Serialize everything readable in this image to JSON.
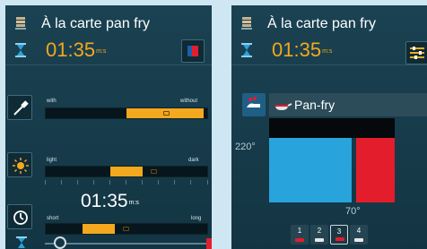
{
  "left": {
    "title": "À la carte pan fry",
    "time": "01:35",
    "time_unit": "m:s",
    "sliders": {
      "with_without": {
        "left_label": "with",
        "right_label": "without",
        "level": 0.5
      },
      "light_dark": {
        "left_label": "light",
        "right_label": "dark",
        "level": 0.5
      },
      "short_long": {
        "left_label": "short",
        "right_label": "long",
        "level": 0.33
      }
    },
    "mid_time": "01:35",
    "mid_time_unit": "m:s"
  },
  "right": {
    "title": "À la carte pan fry",
    "time": "01:35",
    "time_unit": "m:s",
    "program": "Pan-fry",
    "temp_top": "220°",
    "temp_core": "70°",
    "steps": [
      {
        "label": "1",
        "active": false,
        "color": "#e31d2b"
      },
      {
        "label": "2",
        "active": false,
        "color": "#e8e8e8"
      },
      {
        "label": "3",
        "active": true,
        "color": "#e31d2b"
      },
      {
        "label": "4",
        "active": false,
        "color": "#e8e8e8"
      }
    ]
  },
  "colors": {
    "accent": "#f4a81d",
    "steam_blue": "#29a3dc",
    "heat_red": "#e31d2b",
    "panel_bg": "#1b4252"
  }
}
